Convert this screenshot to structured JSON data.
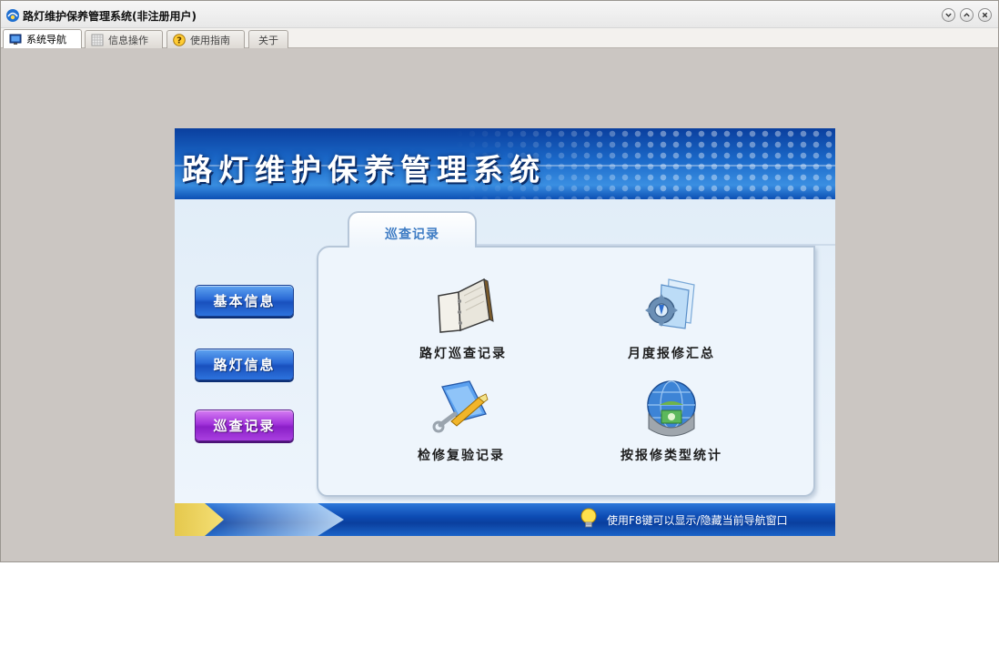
{
  "window": {
    "title": "路灯维护保养管理系统(非注册用户)"
  },
  "tabs": [
    {
      "label": "系统导航",
      "icon": "monitor-icon",
      "active": true
    },
    {
      "label": "信息操作",
      "icon": "grid-icon",
      "active": false
    },
    {
      "label": "使用指南",
      "icon": "help-icon",
      "active": false
    },
    {
      "label": "关于",
      "icon": "",
      "active": false
    }
  ],
  "banner": {
    "title": "路灯维护保养管理系统"
  },
  "nav": [
    {
      "label": "基本信息",
      "active": false
    },
    {
      "label": "路灯信息",
      "active": false
    },
    {
      "label": "巡查记录",
      "active": true
    }
  ],
  "folder": {
    "tab_label": "巡查记录",
    "items": [
      {
        "label": "路灯巡查记录",
        "icon": "binder-icon"
      },
      {
        "label": "月度报修汇总",
        "icon": "gear-document-icon"
      },
      {
        "label": "检修复验记录",
        "icon": "tools-document-icon"
      },
      {
        "label": "按报修类型统计",
        "icon": "globe-money-icon"
      }
    ]
  },
  "footer": {
    "hint": "使用F8键可以显示/隐藏当前导航窗口",
    "icon": "lightbulb-icon"
  },
  "colors": {
    "banner_blue": "#1b69c9",
    "nav_blue": "#2a6ad6",
    "nav_active_purple": "#a133db",
    "folder_label_blue": "#3e7cc4",
    "window_gray": "#cbc6c2"
  }
}
